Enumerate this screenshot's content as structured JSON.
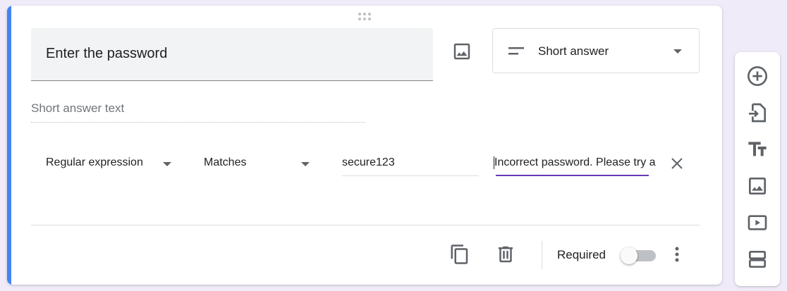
{
  "question": {
    "title": "Enter the password",
    "type_label": "Short answer",
    "answer_placeholder": "Short answer text"
  },
  "validation": {
    "rule_type": "Regular expression",
    "condition": "Matches",
    "pattern": "secure123",
    "error_text": "Incorrect password. Please try again."
  },
  "footer": {
    "required_label": "Required",
    "required_on": false
  },
  "icons": {
    "image": "image-icon",
    "short_answer": "short-text-icon",
    "copy": "copy-icon",
    "delete": "trash-icon",
    "more": "more-vert-icon",
    "clear": "close-icon",
    "add_question": "add-circle-icon",
    "import": "import-icon",
    "title_text": "text-fields-icon",
    "add_image": "image-icon",
    "add_video": "video-icon",
    "add_section": "section-icon"
  },
  "colors": {
    "accent": "#4285f4",
    "focus": "#673ab7",
    "background": "#f0ebf8"
  }
}
